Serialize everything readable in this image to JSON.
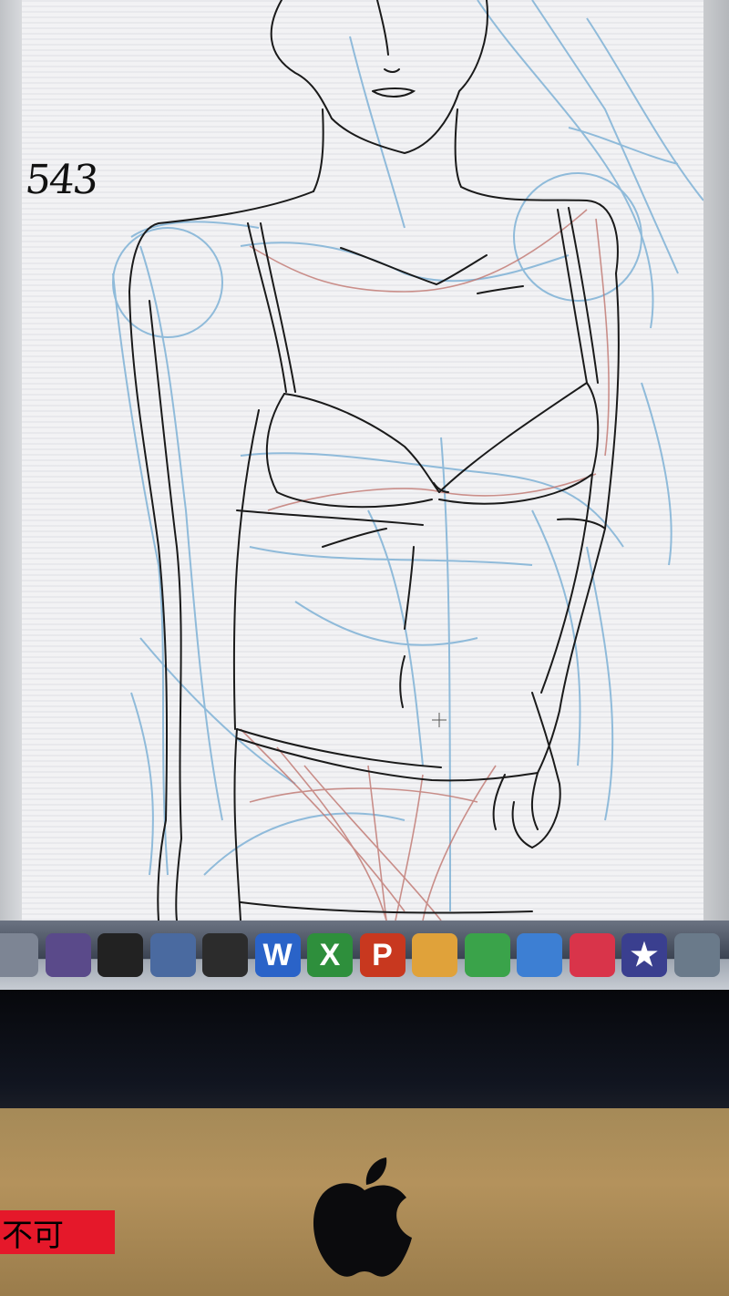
{
  "canvas": {
    "layer_number": "543",
    "colors": {
      "ink": "#1a1a1a",
      "blue_guides": "#7fb2d6",
      "red_guides": "#c0766f",
      "paper": "#f2f2f4"
    }
  },
  "dock": {
    "apps": [
      {
        "name": "image-capture-icon",
        "color": "#7d8594",
        "glyph": ""
      },
      {
        "name": "dvd-player-icon",
        "color": "#5a4a8a",
        "glyph": ""
      },
      {
        "name": "final-cut-clapper-icon",
        "color": "#222",
        "glyph": ""
      },
      {
        "name": "motion-icon",
        "color": "#4a6aa0",
        "glyph": ""
      },
      {
        "name": "compressor-clapper-icon",
        "color": "#2c2c2c",
        "glyph": ""
      },
      {
        "name": "word-icon",
        "color": "#2a63c8",
        "glyph": "W"
      },
      {
        "name": "excel-icon",
        "color": "#2e8f3c",
        "glyph": "X"
      },
      {
        "name": "powerpoint-icon",
        "color": "#c8381f",
        "glyph": "P"
      },
      {
        "name": "pages-icon",
        "color": "#e0a23a",
        "glyph": ""
      },
      {
        "name": "numbers-icon",
        "color": "#3aa34a",
        "glyph": ""
      },
      {
        "name": "keynote-icon",
        "color": "#3d7fd3",
        "glyph": ""
      },
      {
        "name": "davinci-resolve-icon",
        "color": "#d9344a",
        "glyph": ""
      },
      {
        "name": "imovie-icon",
        "color": "#3a3f8f",
        "glyph": "★"
      },
      {
        "name": "iphoto-icon",
        "color": "#6a7a8a",
        "glyph": ""
      }
    ]
  },
  "sticker": {
    "text": "不可",
    "color": "#e5182a"
  }
}
